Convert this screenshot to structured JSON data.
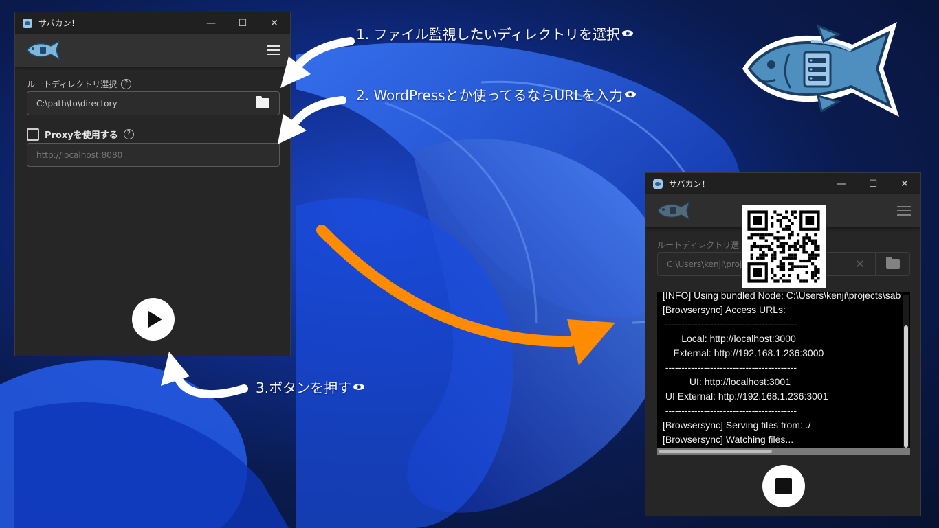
{
  "colors": {
    "arrow_white": "#ffffff",
    "arrow_orange": "#ff8c00",
    "fish_blue": "#4f8fc0",
    "window_bg": "#262626"
  },
  "annotations": {
    "step1": "1. ファイル監視したいディレクトリを選択",
    "step2": "2. WordPressとか使ってるならURLを入力",
    "step3": "3.ボタンを押す"
  },
  "window1": {
    "title": "サバカン！",
    "root_dir_label": "ルートディレクトリ選択",
    "root_dir_value": "C:\\path\\to\\directory",
    "proxy_label": "Proxyを使用する",
    "proxy_placeholder": "http://localhost:8080",
    "icons": [
      "fish-logo-icon",
      "menu-icon",
      "help-icon",
      "folder-icon",
      "play-icon"
    ]
  },
  "window2": {
    "title": "サバカン！",
    "root_dir_label": "ルートディレクトリ選",
    "root_dir_value": "C:\\Users\\kenji\\projec",
    "console_lines": [
      "[INFO] Using bundled Node: C:\\Users\\kenji\\projects\\sab",
      "[Browsersync] Access URLs:",
      " -----------------------------------------",
      "       Local: http://localhost:3000",
      "    External: http://192.168.1.236:3000",
      " -----------------------------------------",
      "          UI: http://localhost:3001",
      " UI External: http://192.168.1.236:3001",
      " -----------------------------------------",
      "[Browsersync] Serving files from: ./",
      "[Browsersync] Watching files..."
    ],
    "icons": [
      "fish-logo-icon",
      "menu-icon",
      "clear-icon",
      "folder-icon",
      "qr-code-icon",
      "stop-icon"
    ]
  }
}
